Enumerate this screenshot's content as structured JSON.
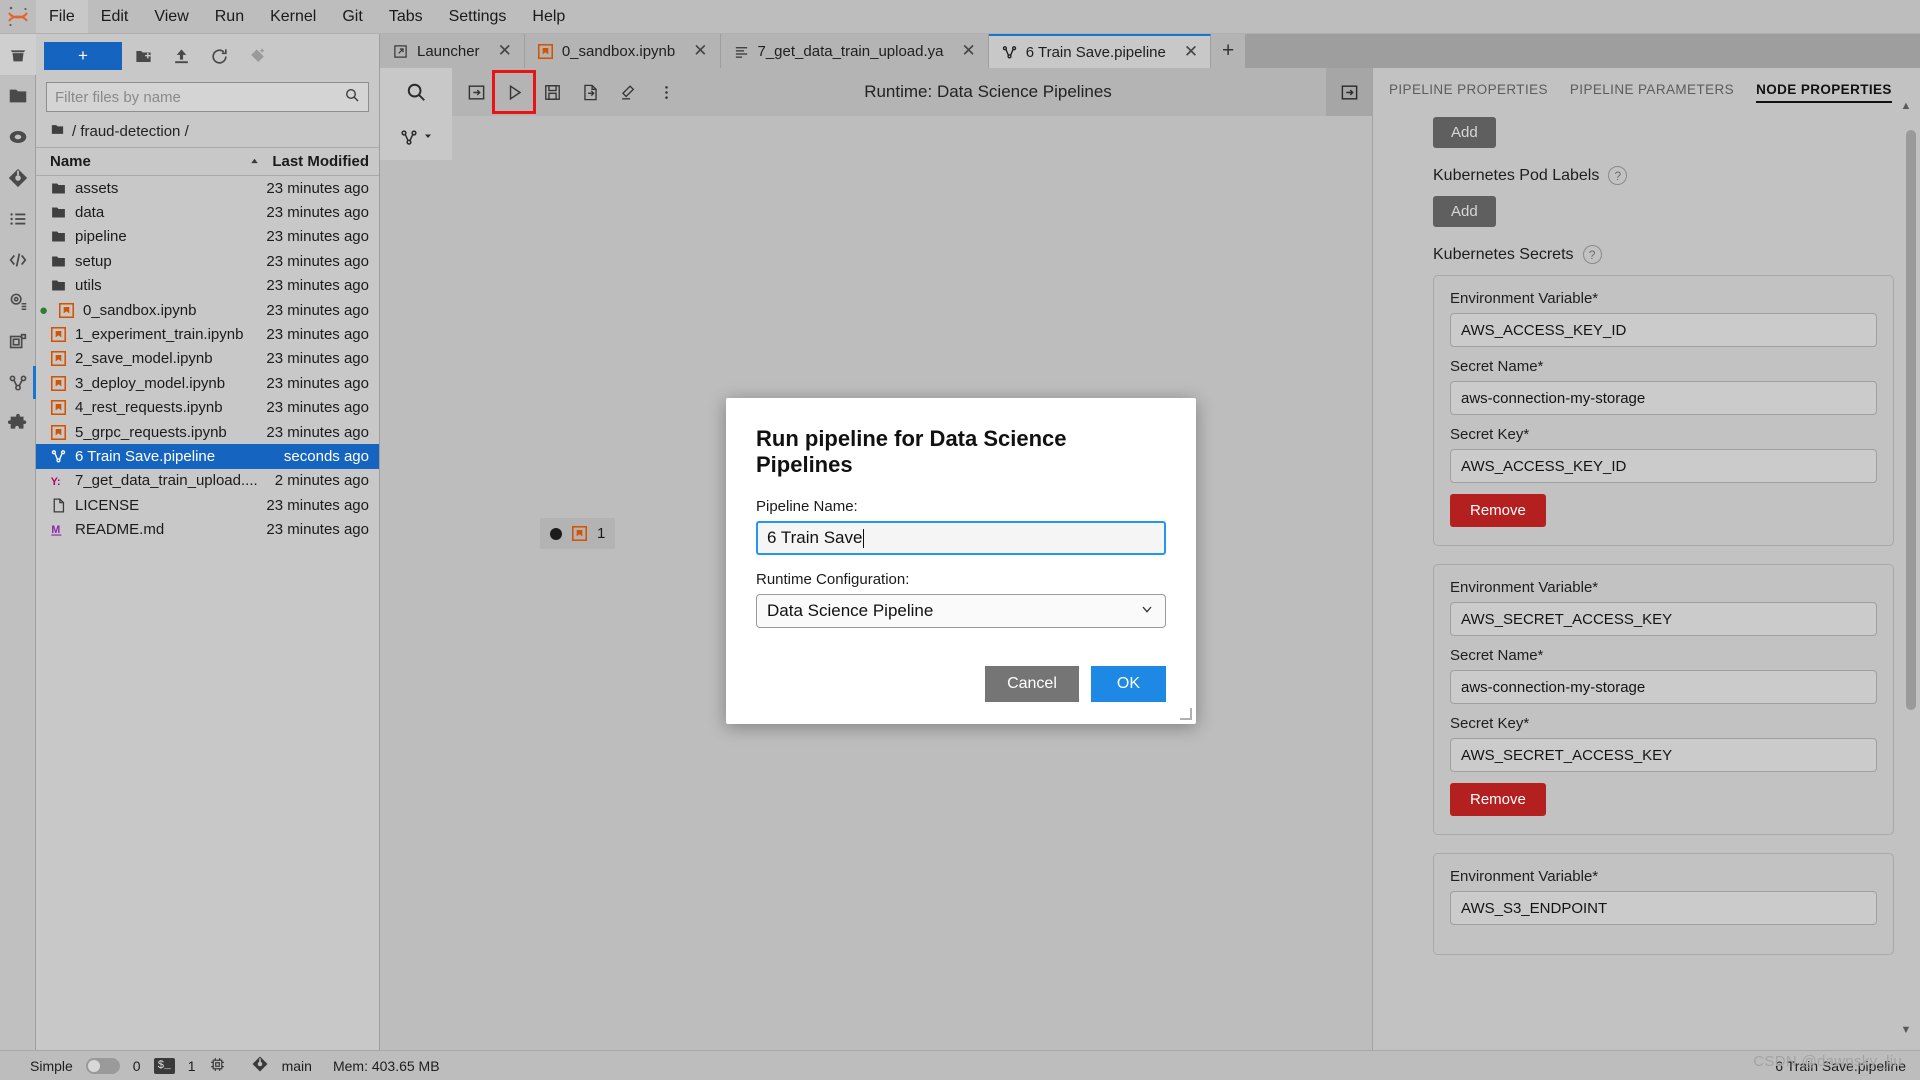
{
  "menubar": {
    "logo": "jupyter-logo",
    "items": [
      {
        "label": "File",
        "active": true
      },
      {
        "label": "Edit",
        "active": false
      },
      {
        "label": "View",
        "active": false
      },
      {
        "label": "Run",
        "active": false
      },
      {
        "label": "Kernel",
        "active": false
      },
      {
        "label": "Git",
        "active": false
      },
      {
        "label": "Tabs",
        "active": false
      },
      {
        "label": "Settings",
        "active": false
      },
      {
        "label": "Help",
        "active": false
      }
    ]
  },
  "activitybar": {
    "icons": [
      {
        "name": "trash-icon",
        "selected": true
      },
      {
        "name": "folder-icon",
        "selected": false
      },
      {
        "name": "running-terminals-icon",
        "selected": false
      },
      {
        "name": "git-icon",
        "selected": false
      },
      {
        "name": "table-of-contents-icon",
        "selected": false
      },
      {
        "name": "code-snippets-icon",
        "selected": false
      },
      {
        "name": "settings-cog-icon",
        "selected": false
      },
      {
        "name": "extension-manager-icon",
        "selected": false
      },
      {
        "name": "pipeline-editor-icon",
        "selected": false
      },
      {
        "name": "puzzle-extension-icon",
        "selected": false
      }
    ]
  },
  "filebrowser": {
    "new_button_label": "+",
    "toolbar_icons": [
      "new-folder-icon",
      "upload-icon",
      "refresh-icon",
      "new-launcher-icon"
    ],
    "filter_placeholder": "Filter files by name",
    "filter_value": "",
    "breadcrumb": "/ fraud-detection /",
    "columns": {
      "name": "Name",
      "last_modified": "Last Modified"
    },
    "sort_indicator": "ascending",
    "rows": [
      {
        "name": "assets",
        "modified": "23 minutes ago",
        "icon": "folder-icon",
        "type": "folder",
        "selected": false,
        "running": false
      },
      {
        "name": "data",
        "modified": "23 minutes ago",
        "icon": "folder-icon",
        "type": "folder",
        "selected": false,
        "running": false
      },
      {
        "name": "pipeline",
        "modified": "23 minutes ago",
        "icon": "folder-icon",
        "type": "folder",
        "selected": false,
        "running": false
      },
      {
        "name": "setup",
        "modified": "23 minutes ago",
        "icon": "folder-icon",
        "type": "folder",
        "selected": false,
        "running": false
      },
      {
        "name": "utils",
        "modified": "23 minutes ago",
        "icon": "folder-icon",
        "type": "folder",
        "selected": false,
        "running": false
      },
      {
        "name": "0_sandbox.ipynb",
        "modified": "23 minutes ago",
        "icon": "notebook-icon",
        "type": "notebook",
        "selected": false,
        "running": true
      },
      {
        "name": "1_experiment_train.ipynb",
        "modified": "23 minutes ago",
        "icon": "notebook-icon",
        "type": "notebook",
        "selected": false,
        "running": false
      },
      {
        "name": "2_save_model.ipynb",
        "modified": "23 minutes ago",
        "icon": "notebook-icon",
        "type": "notebook",
        "selected": false,
        "running": false
      },
      {
        "name": "3_deploy_model.ipynb",
        "modified": "23 minutes ago",
        "icon": "notebook-icon",
        "type": "notebook",
        "selected": false,
        "running": false
      },
      {
        "name": "4_rest_requests.ipynb",
        "modified": "23 minutes ago",
        "icon": "notebook-icon",
        "type": "notebook",
        "selected": false,
        "running": false
      },
      {
        "name": "5_grpc_requests.ipynb",
        "modified": "23 minutes ago",
        "icon": "notebook-icon",
        "type": "notebook",
        "selected": false,
        "running": false
      },
      {
        "name": "6 Train Save.pipeline",
        "modified": "seconds ago",
        "icon": "pipeline-icon",
        "type": "pipeline",
        "selected": true,
        "running": false
      },
      {
        "name": "7_get_data_train_upload....",
        "modified": "2 minutes ago",
        "icon": "yaml-icon",
        "type": "yaml",
        "selected": false,
        "running": false
      },
      {
        "name": "LICENSE",
        "modified": "23 minutes ago",
        "icon": "file-icon",
        "type": "file",
        "selected": false,
        "running": false
      },
      {
        "name": "README.md",
        "modified": "23 minutes ago",
        "icon": "markdown-icon",
        "type": "markdown",
        "selected": false,
        "running": false
      }
    ]
  },
  "tabs": [
    {
      "label": "Launcher",
      "icon": "launcher-icon",
      "active": false
    },
    {
      "label": "0_sandbox.ipynb",
      "icon": "notebook-icon",
      "active": false
    },
    {
      "label": "7_get_data_train_upload.ya",
      "icon": "yaml-file-icon",
      "active": false
    },
    {
      "label": "6 Train Save.pipeline",
      "icon": "pipeline-icon",
      "active": true
    }
  ],
  "tab_add_label": "+",
  "pipeline_toolbar": {
    "search_icon": "search-icon",
    "buttons": [
      {
        "name": "toggle-palette-icon",
        "highlighted": false
      },
      {
        "name": "run-pipeline-icon",
        "highlighted": true
      },
      {
        "name": "save-pipeline-icon",
        "highlighted": false
      },
      {
        "name": "export-pipeline-icon",
        "highlighted": false
      },
      {
        "name": "clear-pipeline-icon",
        "highlighted": false
      },
      {
        "name": "overflow-menu-icon",
        "highlighted": false
      }
    ],
    "runtime_label": "Runtime: Data Science Pipelines",
    "panel_toggle_icon": "open-panel-icon",
    "palette_icon": "node-palette-icon",
    "palette_chevron": "chevron-down-icon"
  },
  "canvas": {
    "nodes": [
      {
        "label": "1",
        "icon": "notebook-icon"
      }
    ]
  },
  "properties": {
    "tabs": [
      {
        "label": "PIPELINE PROPERTIES",
        "active": false
      },
      {
        "label": "PIPELINE PARAMETERS",
        "active": false
      },
      {
        "label": "NODE PROPERTIES",
        "active": true
      }
    ],
    "top_add_label": "Add",
    "pod_labels_title": "Kubernetes Pod Labels",
    "pod_labels_add": "Add",
    "secrets_title": "Kubernetes Secrets",
    "help_glyph": "?",
    "field_labels": {
      "env": "Environment Variable*",
      "secret_name": "Secret Name*",
      "secret_key": "Secret Key*"
    },
    "remove_label": "Remove",
    "secrets": [
      {
        "env": "AWS_ACCESS_KEY_ID",
        "secret_name": "aws-connection-my-storage",
        "secret_key": "AWS_ACCESS_KEY_ID"
      },
      {
        "env": "AWS_SECRET_ACCESS_KEY",
        "secret_name": "aws-connection-my-storage",
        "secret_key": "AWS_SECRET_ACCESS_KEY"
      },
      {
        "env": "AWS_S3_ENDPOINT",
        "secret_name": "",
        "secret_key": ""
      }
    ]
  },
  "modal": {
    "title": "Run pipeline for Data Science Pipelines",
    "pipeline_name_label": "Pipeline Name:",
    "pipeline_name_value": "6 Train Save",
    "runtime_config_label": "Runtime Configuration:",
    "runtime_config_value": "Data Science Pipeline",
    "cancel_label": "Cancel",
    "ok_label": "OK"
  },
  "statusbar": {
    "simple_label": "Simple",
    "simple_toggle_on": false,
    "kernel_count": "0",
    "terminal_badge": "$_",
    "terminal_count": "1",
    "git_branch": "main",
    "memory": "Mem: 403.65 MB",
    "current_file": "6 Train Save.pipeline",
    "watermark": "CSDN @dawnsky_liu"
  },
  "colors": {
    "accent_blue": "#1565c0",
    "select_blue": "#1876d2",
    "danger_red": "#b4201f",
    "highlight_red": "#e81313",
    "notebook_orange": "#d35400"
  }
}
